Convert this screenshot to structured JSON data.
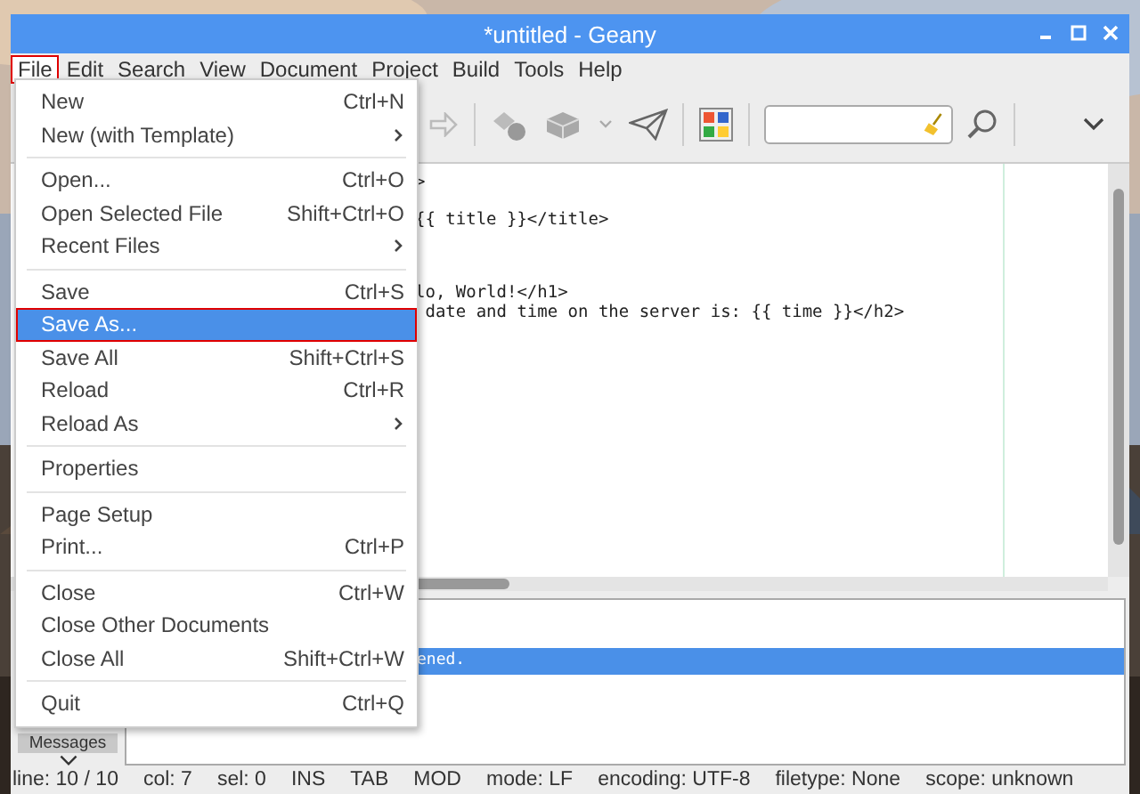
{
  "window": {
    "title": "*untitled - Geany"
  },
  "menubar": [
    {
      "label": "File",
      "selected": true,
      "outlined": true
    },
    {
      "label": "Edit",
      "selected": false,
      "outlined": false
    },
    {
      "label": "Search",
      "selected": false,
      "outlined": false
    },
    {
      "label": "View",
      "selected": false,
      "outlined": false
    },
    {
      "label": "Document",
      "selected": false,
      "outlined": false
    },
    {
      "label": "Project",
      "selected": false,
      "outlined": false
    },
    {
      "label": "Build",
      "selected": false,
      "outlined": false
    },
    {
      "label": "Tools",
      "selected": false,
      "outlined": false
    },
    {
      "label": "Help",
      "selected": false,
      "outlined": false
    }
  ],
  "file_menu": [
    [
      {
        "label": "New",
        "shortcut": "Ctrl+N",
        "submenu": false,
        "selected": false,
        "outlined": false
      },
      {
        "label": "New (with Template)",
        "submenu": true,
        "selected": false,
        "outlined": false
      }
    ],
    [
      {
        "label": "Open...",
        "shortcut": "Ctrl+O",
        "submenu": false,
        "selected": false,
        "outlined": false
      },
      {
        "label": "Open Selected File",
        "shortcut": "Shift+Ctrl+O",
        "submenu": false,
        "selected": false,
        "outlined": false
      },
      {
        "label": "Recent Files",
        "submenu": true,
        "selected": false,
        "outlined": false
      }
    ],
    [
      {
        "label": "Save",
        "shortcut": "Ctrl+S",
        "submenu": false,
        "selected": false,
        "outlined": false
      },
      {
        "label": "Save As...",
        "submenu": false,
        "selected": true,
        "outlined": true
      },
      {
        "label": "Save All",
        "shortcut": "Shift+Ctrl+S",
        "submenu": false,
        "selected": false,
        "outlined": false
      },
      {
        "label": "Reload",
        "shortcut": "Ctrl+R",
        "submenu": false,
        "selected": false,
        "outlined": false
      },
      {
        "label": "Reload As",
        "submenu": true,
        "selected": false,
        "outlined": false
      }
    ],
    [
      {
        "label": "Properties",
        "submenu": false,
        "selected": false,
        "outlined": false
      }
    ],
    [
      {
        "label": "Page Setup",
        "submenu": false,
        "selected": false,
        "outlined": false
      },
      {
        "label": "Print...",
        "shortcut": "Ctrl+P",
        "submenu": false,
        "selected": false,
        "outlined": false
      }
    ],
    [
      {
        "label": "Close",
        "shortcut": "Ctrl+W",
        "submenu": false,
        "selected": false,
        "outlined": false
      },
      {
        "label": "Close Other Documents",
        "submenu": false,
        "selected": false,
        "outlined": false
      },
      {
        "label": "Close All",
        "shortcut": "Shift+Ctrl+W",
        "submenu": false,
        "selected": false,
        "outlined": false
      }
    ],
    [
      {
        "label": "Quit",
        "shortcut": "Ctrl+Q",
        "submenu": false,
        "selected": false,
        "outlined": false
      }
    ]
  ],
  "editor": {
    "blocks": [
      [
        ">"
      ],
      [
        "{{ title }}</title>"
      ],
      [
        "lo, World!</h1>",
        " date and time on the server is: {{ time }}</h2>"
      ]
    ]
  },
  "messages": {
    "rows": [
      {
        "text": "",
        "selected": false
      },
      {
        "text": "ened.",
        "selected": true
      }
    ],
    "tab": "Messages"
  },
  "status_bar": [
    "line: 10 / 10",
    "col: 7",
    "sel: 0",
    "INS",
    "TAB",
    "MOD",
    "mode: LF",
    "encoding: UTF-8",
    "filetype: None",
    "scope: unknown"
  ]
}
